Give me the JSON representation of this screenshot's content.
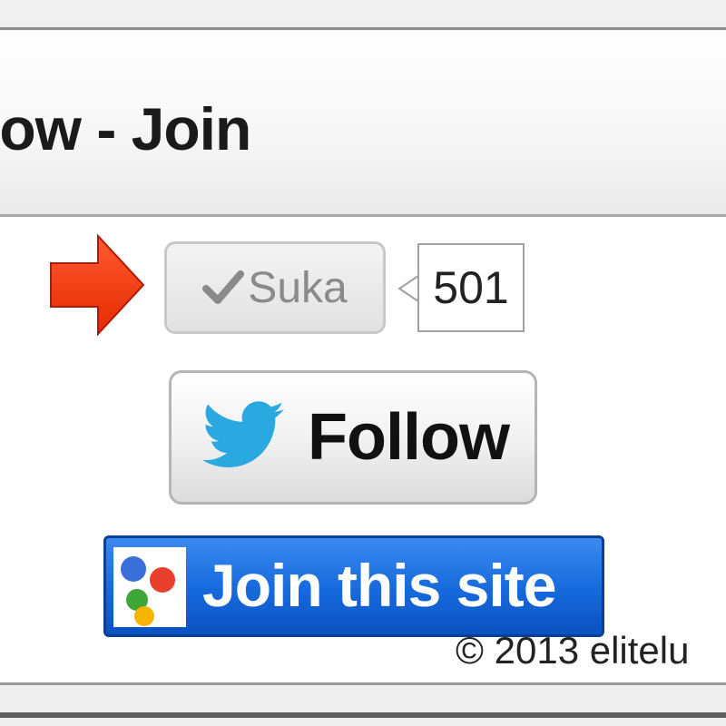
{
  "header": {
    "title": "low - Join"
  },
  "like_button": {
    "label": "Suka",
    "icon": "check-icon",
    "count": "501"
  },
  "follow_button": {
    "label": "Follow",
    "icon": "twitter-bird-icon"
  },
  "join_button": {
    "label": "Join this site",
    "icon": "google-friend-connect-icon"
  },
  "footer": {
    "copyright": "© 2013 elitelu"
  },
  "colors": {
    "arrow": "#ff3a10",
    "twitter_blue": "#2aa9e0",
    "join_blue": "#1669dc"
  }
}
